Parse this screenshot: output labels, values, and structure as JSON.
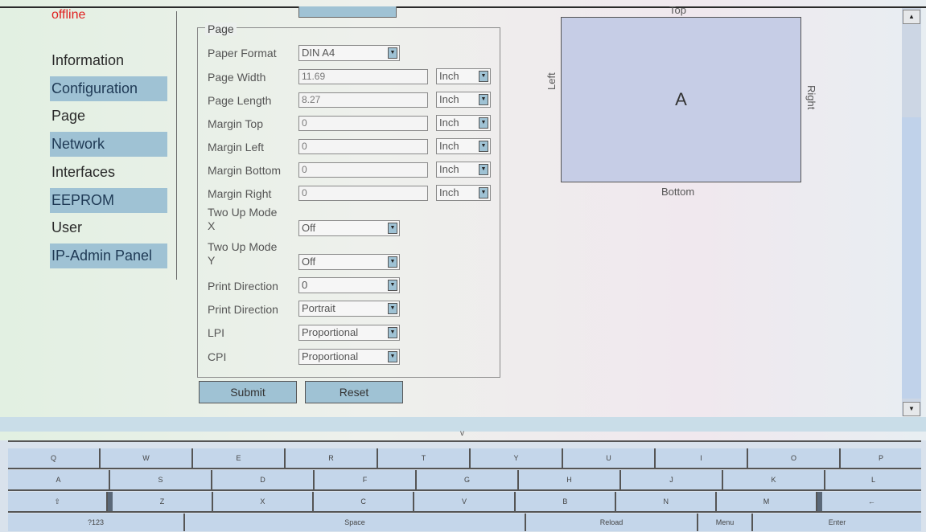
{
  "status": "offline",
  "nav": [
    {
      "label": "Information",
      "highlighted": false
    },
    {
      "label": "Configuration",
      "highlighted": true
    },
    {
      "label": "Page",
      "highlighted": false
    },
    {
      "label": "Network",
      "highlighted": true
    },
    {
      "label": "Interfaces",
      "highlighted": false
    },
    {
      "label": "EEPROM",
      "highlighted": true
    },
    {
      "label": "User",
      "highlighted": false
    },
    {
      "label": "IP-Admin Panel",
      "highlighted": true
    }
  ],
  "form": {
    "legend": "Page",
    "paper_format": {
      "label": "Paper Format",
      "value": "DIN A4"
    },
    "page_width": {
      "label": "Page Width",
      "value": "11.69",
      "unit": "Inch"
    },
    "page_length": {
      "label": "Page Length",
      "value": "8.27",
      "unit": "Inch"
    },
    "margin_top": {
      "label": "Margin Top",
      "value": "0",
      "unit": "Inch"
    },
    "margin_left": {
      "label": "Margin Left",
      "value": "0",
      "unit": "Inch"
    },
    "margin_bottom": {
      "label": "Margin Bottom",
      "value": "0",
      "unit": "Inch"
    },
    "margin_right": {
      "label": "Margin Right",
      "value": "0",
      "unit": "Inch"
    },
    "two_up_x": {
      "label1": "Two Up Mode",
      "label2": "X",
      "value": "Off"
    },
    "two_up_y": {
      "label1": "Two Up Mode",
      "label2": "Y",
      "value": "Off"
    },
    "print_direction_1": {
      "label": "Print Direction",
      "value": "0"
    },
    "print_direction_2": {
      "label": "Print Direction",
      "value": "Portrait"
    },
    "lpi": {
      "label": "LPI",
      "value": "Proportional"
    },
    "cpi": {
      "label": "CPI",
      "value": "Proportional"
    },
    "submit": "Submit",
    "reset": "Reset"
  },
  "preview": {
    "letter": "A",
    "top": "Top",
    "bottom": "Bottom",
    "left": "Left",
    "right": "Right"
  },
  "keyboard": {
    "hide_glyph": "v",
    "row1": [
      "Q",
      "W",
      "E",
      "R",
      "T",
      "Y",
      "U",
      "I",
      "O",
      "P"
    ],
    "row2": [
      "A",
      "S",
      "D",
      "F",
      "G",
      "H",
      "J",
      "K",
      "L"
    ],
    "row3": [
      "⇧",
      "Z",
      "X",
      "C",
      "V",
      "B",
      "N",
      "M",
      "←"
    ],
    "row4": [
      "?123",
      "Space",
      "Reload",
      "Menu",
      "Enter"
    ]
  },
  "scrollbar": {
    "up": "▲",
    "down": "▼"
  }
}
